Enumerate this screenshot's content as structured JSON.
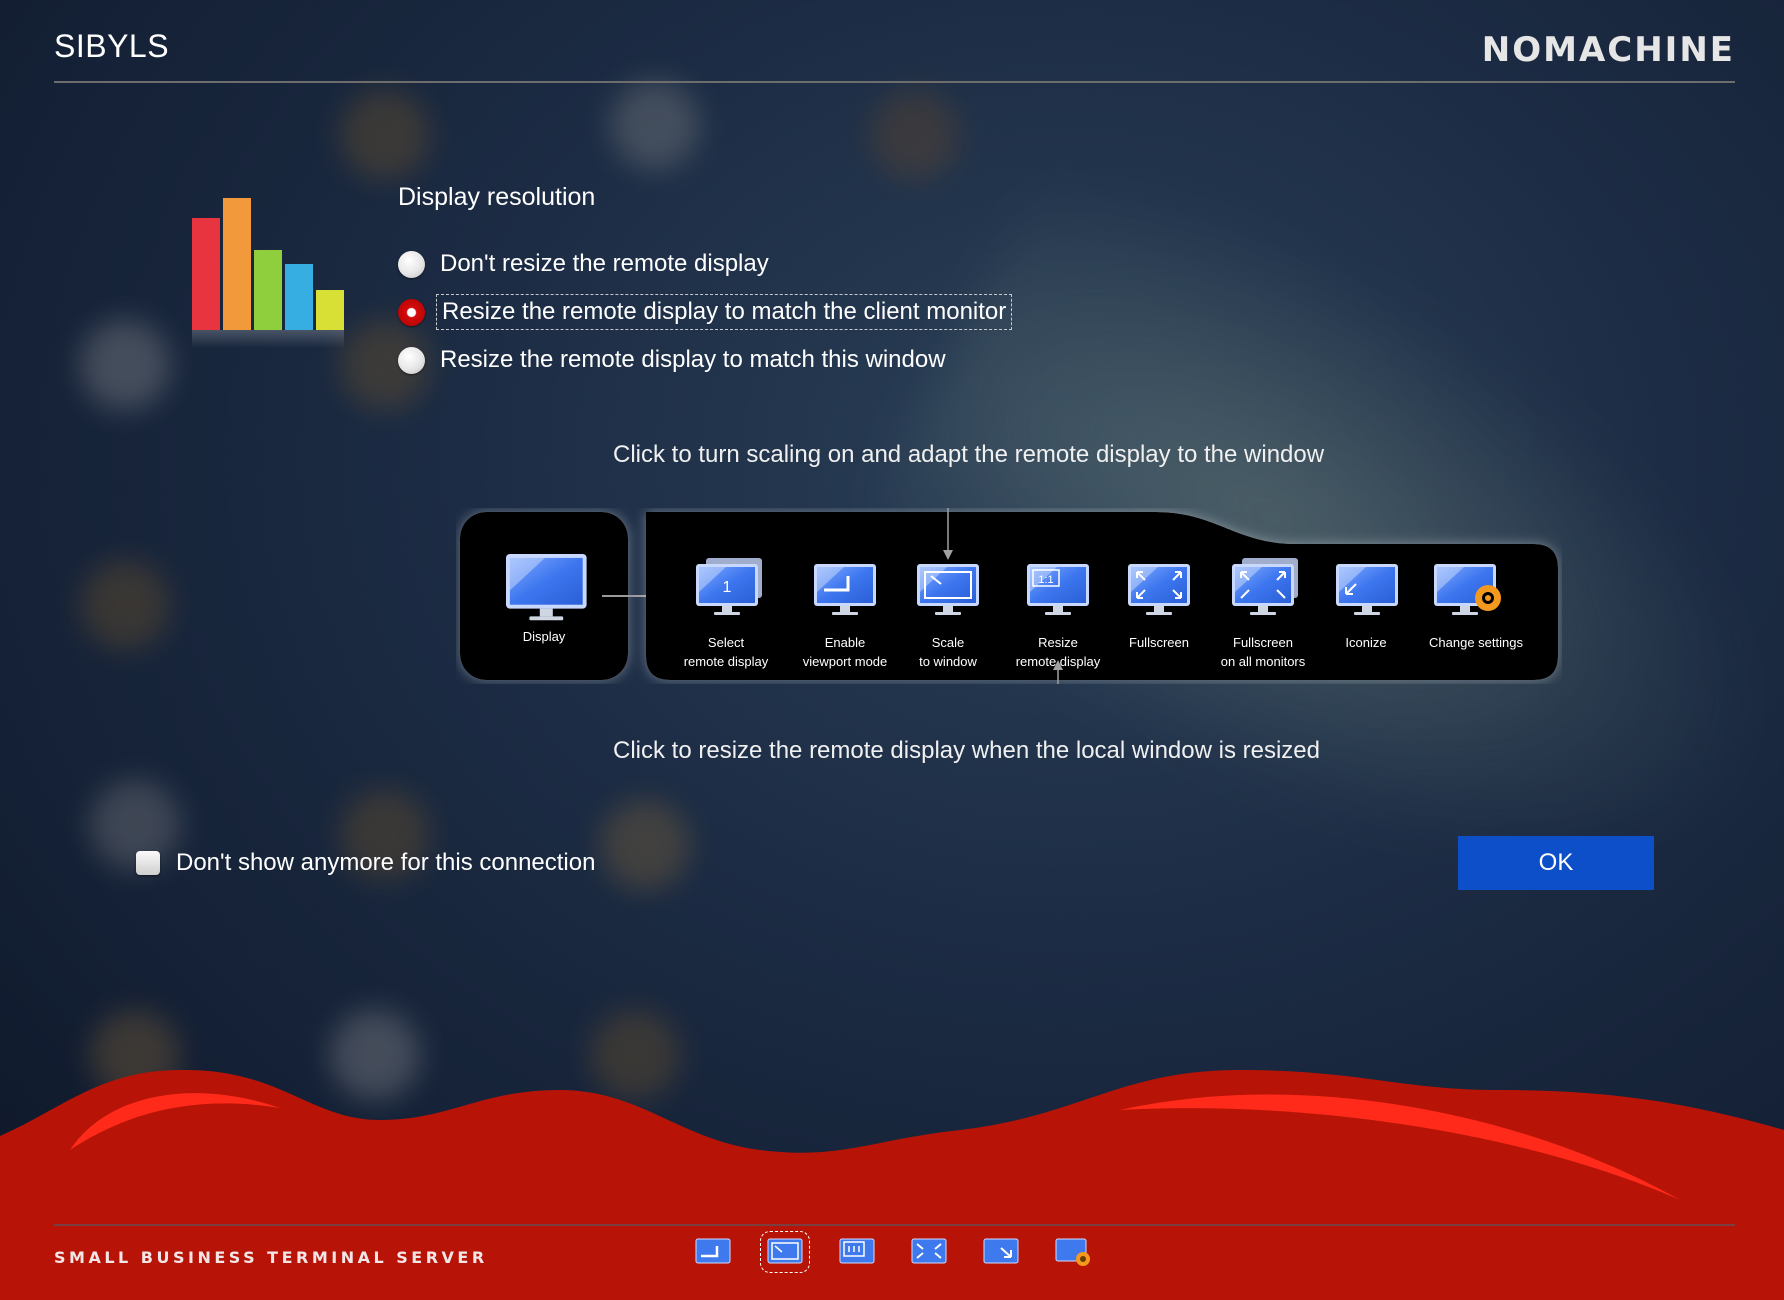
{
  "app": {
    "title": "SIBYLS",
    "brand": "NOMACHINE"
  },
  "section": {
    "title": "Display resolution"
  },
  "options": [
    {
      "label": "Don't resize the remote display",
      "checked": false
    },
    {
      "label": "Resize the remote display to match the client monitor",
      "checked": true
    },
    {
      "label": "Resize the remote display to match this window",
      "checked": false
    }
  ],
  "diagram": {
    "hint_top": "Click to turn scaling on and adapt the remote display to the window",
    "hint_bottom": "Click to resize the remote display when the local window is resized",
    "display_label": "Display",
    "items": [
      {
        "line1": "Select",
        "line2": "remote display",
        "icon": "select-remote-display-icon"
      },
      {
        "line1": "Enable",
        "line2": "viewport mode",
        "icon": "viewport-mode-icon"
      },
      {
        "line1": "Scale",
        "line2": "to window",
        "icon": "scale-to-window-icon"
      },
      {
        "line1": "Resize",
        "line2": "remote display",
        "icon": "resize-remote-display-icon"
      },
      {
        "line1": "Fullscreen",
        "line2": "",
        "icon": "fullscreen-icon"
      },
      {
        "line1": "Fullscreen",
        "line2": "on all monitors",
        "icon": "fullscreen-all-monitors-icon"
      },
      {
        "line1": "Iconize",
        "line2": "",
        "icon": "iconize-icon"
      },
      {
        "line1": "Change settings",
        "line2": "",
        "icon": "change-settings-icon"
      }
    ],
    "select_badge": "1",
    "resize_badge": "1:1"
  },
  "checkbox": {
    "label": "Don't show anymore for this connection",
    "checked": false
  },
  "ok_button": {
    "label": "OK"
  },
  "footer": {
    "text": "SMALL BUSINESS TERMINAL SERVER",
    "icons": [
      "viewport-mode-icon",
      "scale-to-window-icon",
      "resize-remote-display-icon",
      "fullscreen-icon",
      "iconize-icon",
      "change-settings-icon"
    ],
    "active_icon": "scale-to-window-icon"
  },
  "colors": {
    "accent_blue": "#0c4fc9",
    "footer_red": "#b71407",
    "radio_selected": "#d30c0c",
    "monitor_blue": "#3f79ee"
  }
}
